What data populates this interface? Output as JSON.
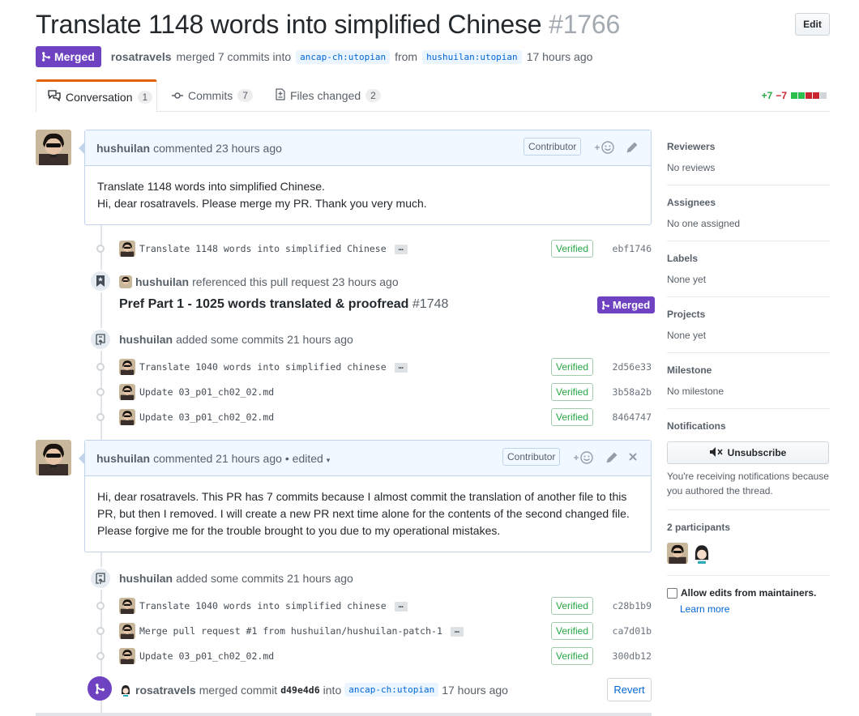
{
  "header": {
    "title": "Translate 1148 words into simplified Chinese",
    "number": "#1766",
    "edit_label": "Edit",
    "state_label": "Merged",
    "merger": "rosatravels",
    "merged_text": "merged 7 commits into",
    "base_branch": "ancap-ch:utopian",
    "from_text": "from",
    "head_branch": "hushuilan:utopian",
    "time": "17 hours ago"
  },
  "tabs": [
    {
      "label": "Conversation",
      "count": "1"
    },
    {
      "label": "Commits",
      "count": "7"
    },
    {
      "label": "Files changed",
      "count": "2"
    }
  ],
  "diffstat": {
    "additions": "+7",
    "deletions": "−7"
  },
  "comment1": {
    "author": "hushuilan",
    "action": "commented 23 hours ago",
    "badge": "Contributor",
    "line1": "Translate 1148 words into simplified Chinese.",
    "line2": "Hi, dear rosatravels. Please merge my PR. Thank you very much."
  },
  "commit_groups": {
    "c1": {
      "message": "Translate 1148 words into simplified Chinese",
      "verified": "Verified",
      "sha": "ebf1746"
    },
    "ref": {
      "author": "hushuilan",
      "action": "referenced this pull request 23 hours ago",
      "title": "Pref Part 1 - 1025 words translated & proofread",
      "number": "#1748",
      "state": "Merged"
    },
    "added1": {
      "author": "hushuilan",
      "action": "added some commits 21 hours ago"
    },
    "c2": {
      "message": "Translate 1040 words into simplified chinese",
      "verified": "Verified",
      "sha": "2d56e33"
    },
    "c3": {
      "message": "Update 03_p01_ch02_02.md",
      "verified": "Verified",
      "sha": "3b58a2b"
    },
    "c4": {
      "message": "Update 03_p01_ch02_02.md",
      "verified": "Verified",
      "sha": "8464747"
    },
    "added2": {
      "author": "hushuilan",
      "action": "added some commits 21 hours ago"
    },
    "c5": {
      "message": "Translate 1040 words into simplified chinese",
      "verified": "Verified",
      "sha": "c28b1b9"
    },
    "c6": {
      "message": "Merge pull request #1 from hushuilan/hushuilan-patch-1",
      "verified": "Verified",
      "sha": "ca7d01b"
    },
    "c7": {
      "message": "Update 03_p01_ch02_02.md",
      "verified": "Verified",
      "sha": "300db12"
    }
  },
  "comment2": {
    "author": "hushuilan",
    "action": "commented 21 hours ago",
    "edited": "• edited",
    "badge": "Contributor",
    "line1": "Hi, dear rosatravels. This PR has 7 commits because I almost commit the translation of another file to this",
    "line2": "PR, but then I removed. I will create a new PR next time alone for the contents of the second changed file.",
    "line3": "Please forgive me for the trouble brought to you due to my operational mistakes."
  },
  "merge_event": {
    "author": "rosatravels",
    "action": "merged commit",
    "sha": "d49e4d6",
    "into": "into",
    "branch": "ancap-ch:utopian",
    "time": "17 hours ago",
    "revert_label": "Revert"
  },
  "sidebar": {
    "reviewers": {
      "heading": "Reviewers",
      "value": "No reviews"
    },
    "assignees": {
      "heading": "Assignees",
      "value": "No one assigned"
    },
    "labels": {
      "heading": "Labels",
      "value": "None yet"
    },
    "projects": {
      "heading": "Projects",
      "value": "None yet"
    },
    "milestone": {
      "heading": "Milestone",
      "value": "No milestone"
    },
    "notifications": {
      "heading": "Notifications",
      "button": "Unsubscribe",
      "note": "You're receiving notifications because you authored the thread."
    },
    "participants": {
      "heading": "2 participants"
    },
    "allow_edits": {
      "label": "Allow edits from maintainers.",
      "link": "Learn more"
    }
  },
  "colors": {
    "merged": "#6f42c1",
    "verified": "#28a745",
    "link": "#0366d6",
    "add": "#28a745",
    "del": "#cb2431"
  },
  "icons": [
    "git-merge-icon",
    "comment-icon",
    "commit-icon",
    "file-diff-icon",
    "bookmark-icon",
    "repo-push-icon",
    "mute-icon",
    "smiley-icon",
    "pencil-icon",
    "close-icon"
  ]
}
